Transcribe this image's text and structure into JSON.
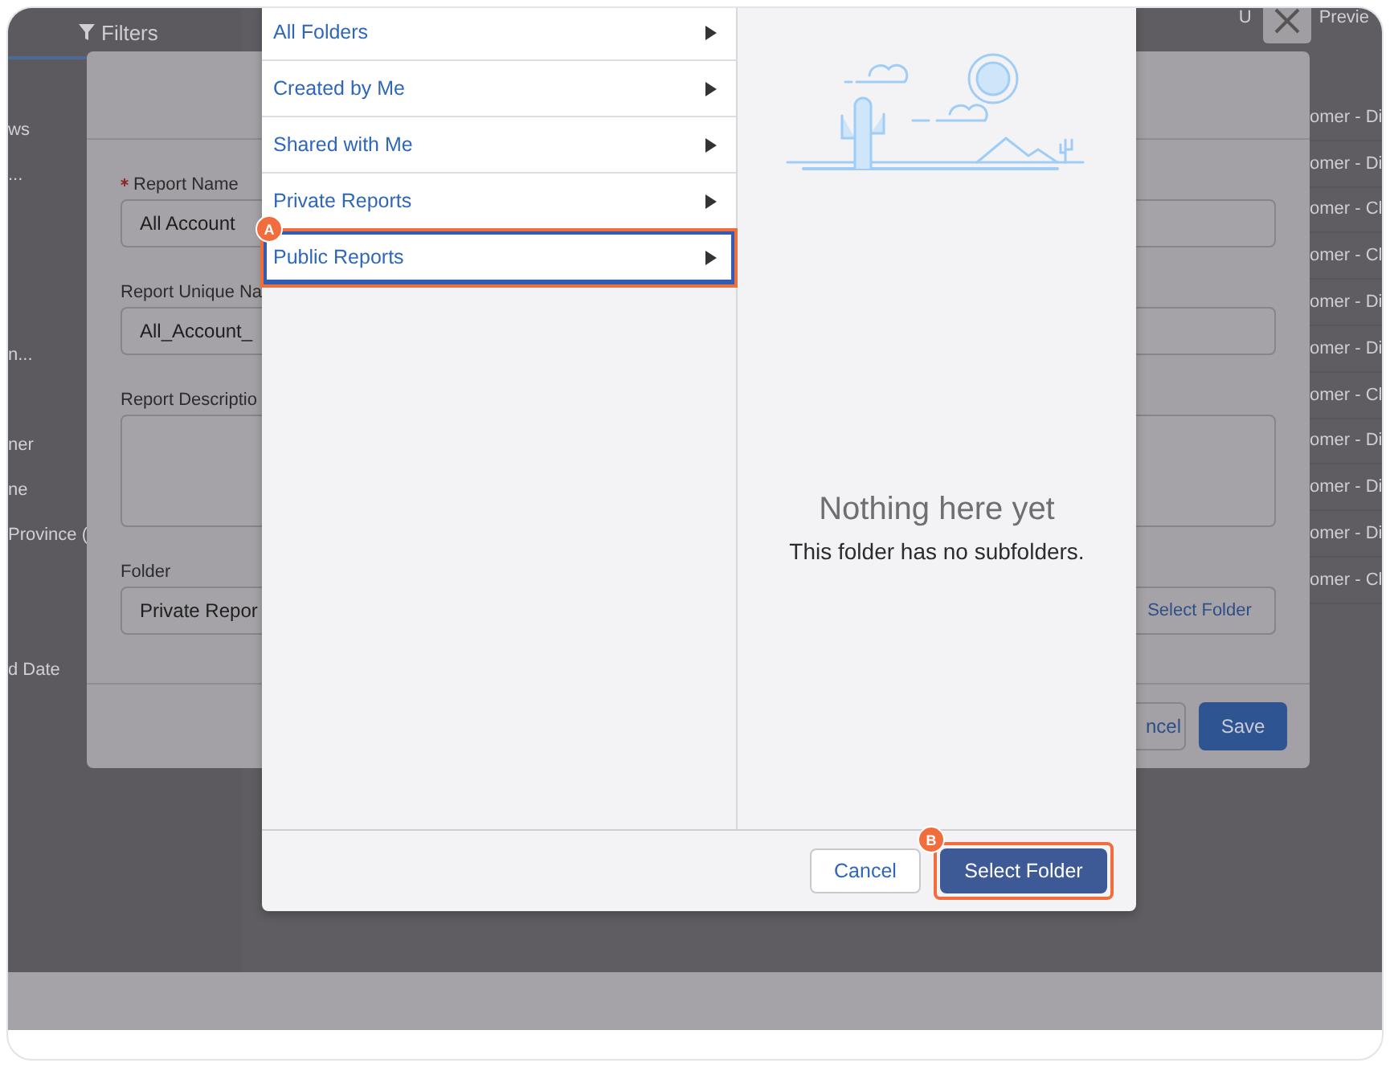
{
  "background_page": {
    "filters_tab": "Filters",
    "sidebar_items": [
      "ws",
      "...",
      "n...",
      "ner",
      "ne",
      "Province (",
      "d Date"
    ],
    "header_texts": [
      "U",
      "Previe"
    ],
    "rows": [
      "omer - Di",
      "omer - Di",
      "omer - Cl",
      "omer - Cl",
      "omer - Di",
      "omer - Di",
      "omer - Cl",
      "omer - Di",
      "omer - Di",
      "omer - Di",
      "omer - Cl"
    ]
  },
  "save_dialog": {
    "fields": [
      {
        "label": "Report Name",
        "required": true,
        "kind": "input",
        "value": "All Account"
      },
      {
        "label": "Report Unique Na",
        "required": false,
        "kind": "input",
        "value": "All_Account_"
      },
      {
        "label": "Report Descriptio",
        "required": false,
        "kind": "textarea"
      },
      {
        "label": "Folder",
        "required": false,
        "kind": "input",
        "value": "Private Repor",
        "button": "Select Folder"
      }
    ],
    "cancel": "ncel",
    "save": "Save"
  },
  "folder_picker": {
    "folders": [
      {
        "label": "All Folders",
        "selected": false
      },
      {
        "label": "Created by Me",
        "selected": false
      },
      {
        "label": "Shared with Me",
        "selected": false
      },
      {
        "label": "Private Reports",
        "selected": false
      },
      {
        "label": "Public Reports",
        "selected": true,
        "annotation": "A"
      }
    ],
    "empty_title": "Nothing here yet",
    "empty_text": "This folder has no subfolders.",
    "cancel": "Cancel",
    "confirm": "Select Folder",
    "confirm_annotation": "B"
  }
}
